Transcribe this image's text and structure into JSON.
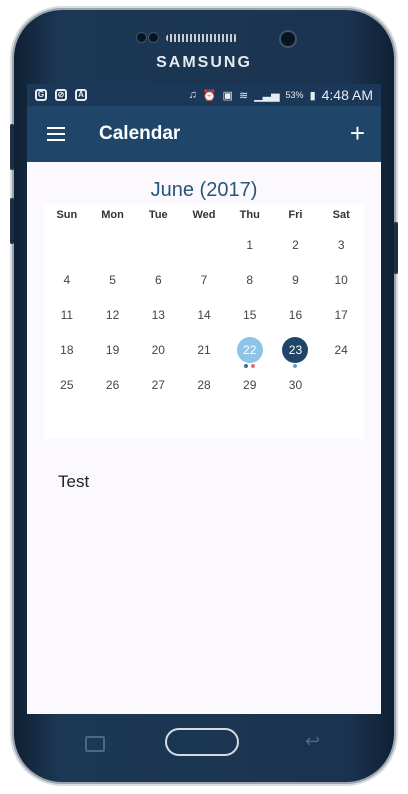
{
  "device": {
    "brand": "SAMSUNG"
  },
  "status_bar": {
    "left_icons": [
      "G",
      "⊘",
      "A"
    ],
    "wifi_glyph": "≋",
    "battery": "53%",
    "time": "4:48 AM"
  },
  "app_bar": {
    "title": "Calendar",
    "add_label": "+"
  },
  "calendar": {
    "month_title": "June (2017)",
    "weekdays": [
      "Sun",
      "Mon",
      "Tue",
      "Wed",
      "Thu",
      "Fri",
      "Sat"
    ],
    "weeks": [
      [
        "",
        "",
        "",
        "",
        "1",
        "2",
        "3"
      ],
      [
        "4",
        "5",
        "6",
        "7",
        "8",
        "9",
        "10"
      ],
      [
        "11",
        "12",
        "13",
        "14",
        "15",
        "16",
        "17"
      ],
      [
        "18",
        "19",
        "20",
        "21",
        "22",
        "23",
        "24"
      ],
      [
        "25",
        "26",
        "27",
        "28",
        "29",
        "30",
        ""
      ]
    ],
    "today": "22",
    "selected": "23",
    "event_dots": {
      "22": [
        "#3d6d9a",
        "#e57373"
      ],
      "23": [
        "#5fa0d0"
      ]
    },
    "colors": {
      "today_bg": "#8dc4e8",
      "selected_bg": "#1f4668"
    }
  },
  "event": {
    "title": "Test"
  },
  "navbar": {
    "back_glyph": "↩"
  }
}
